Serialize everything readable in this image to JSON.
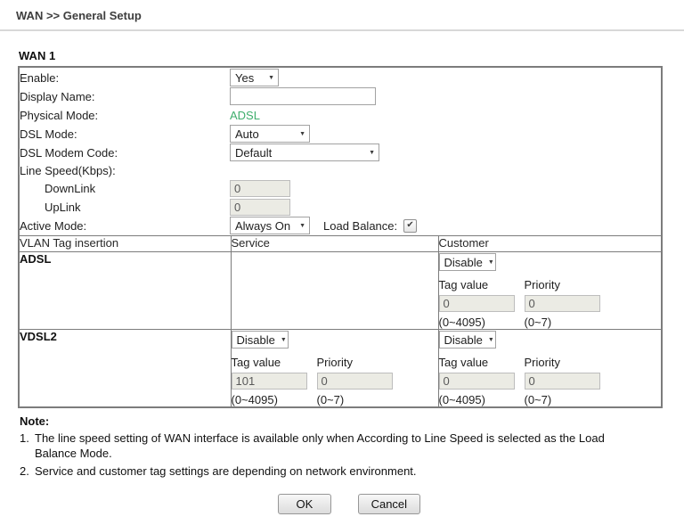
{
  "icons": {
    "select_arrow": "▼",
    "checkbox_check": "✔"
  },
  "colors": {
    "physical_mode_green": "#3fae6d",
    "title_text": "#3e3e3e",
    "table_border": "#7c7c7c"
  },
  "header": {
    "title": "WAN >> General Setup"
  },
  "wan1": {
    "heading": "WAN 1",
    "enable_label": "Enable:",
    "enable_value": "Yes",
    "display_name_label": "Display Name:",
    "display_name_value": "",
    "physical_mode_label": "Physical Mode:",
    "physical_mode_value": "ADSL",
    "dsl_mode_label": "DSL Mode:",
    "dsl_mode_value": "Auto",
    "dsl_modem_code_label": "DSL Modem Code:",
    "dsl_modem_code_value": "Default",
    "line_speed_label": "Line Speed(Kbps):",
    "downlink_label": "DownLink",
    "downlink_value": "0",
    "uplink_label": "UpLink",
    "uplink_value": "0",
    "active_mode_label": "Active Mode:",
    "active_mode_value": "Always On",
    "load_balance_label": "Load Balance:",
    "load_balance_checked": true
  },
  "vlan_table": {
    "headers": [
      "VLAN Tag insertion",
      "Service",
      "Customer"
    ],
    "tag_value_label": "Tag value",
    "priority_label": "Priority",
    "tag_range": "(0~4095)",
    "priority_range": "(0~7)",
    "rows": [
      {
        "name": "ADSL",
        "customer": {
          "mode": "Disable",
          "tag_value": "0",
          "priority_value": "0"
        }
      },
      {
        "name": "VDSL2",
        "service": {
          "mode": "Disable",
          "tag_value": "101",
          "priority_value": "0"
        },
        "customer": {
          "mode": "Disable",
          "tag_value": "0",
          "priority_value": "0"
        }
      }
    ]
  },
  "notes": {
    "heading": "Note:",
    "items": [
      {
        "num": "1.",
        "text": "The line speed setting of WAN interface is available only when According to Line Speed is selected as the Load Balance Mode."
      },
      {
        "num": "2.",
        "text": "Service and customer tag settings are depending on network environment."
      }
    ]
  },
  "buttons": {
    "ok": "OK",
    "cancel": "Cancel"
  }
}
